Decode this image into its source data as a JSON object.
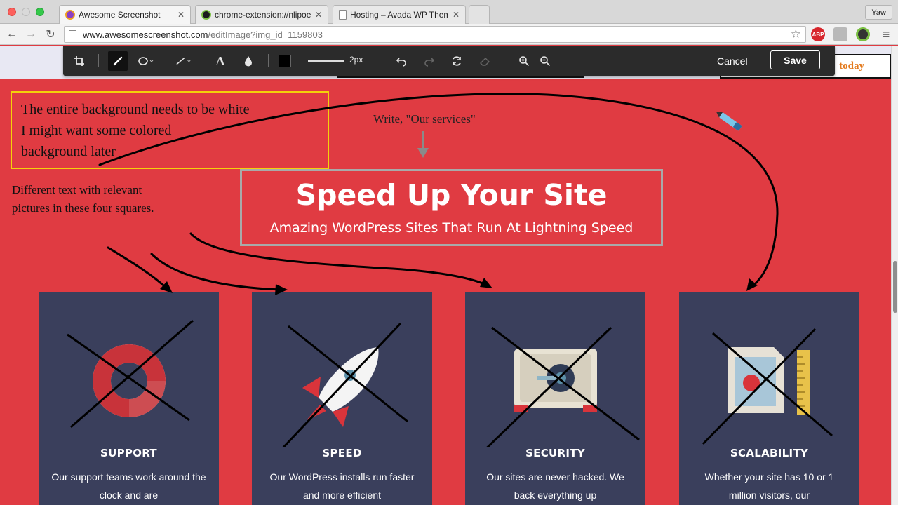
{
  "browser": {
    "profile_label": "Yaw",
    "tabs": [
      {
        "label": "Awesome Screenshot",
        "close": "✕",
        "icon_color": "#8a3fc4"
      },
      {
        "label": "chrome-extension://nlipoe",
        "close": "✕",
        "icon_color": "#1c1c1c"
      },
      {
        "label": "Hosting – Avada WP Theme",
        "close": "✕",
        "icon_color": "#ffffff"
      }
    ],
    "url_host": "www.awesomescreenshot.com",
    "url_path": "/editImage?img_id=1159803",
    "extensions": [
      {
        "name": "adblock-plus-icon",
        "label": "ABP",
        "color": "#d7262c"
      },
      {
        "name": "document-extension-icon",
        "label": "",
        "color": "#b9b9b9"
      },
      {
        "name": "screenshot-extension-icon",
        "label": "",
        "color": "#333333"
      }
    ]
  },
  "editor": {
    "line_width_label": "2px",
    "cancel_label": "Cancel",
    "save_label": "Save",
    "active_color": "#000000"
  },
  "site": {
    "header_cta": "today",
    "hero_title": "Speed Up Your Site",
    "hero_subtitle": "Amazing WordPress Sites That Run At Lightning Speed",
    "cards": [
      {
        "title": "SUPPORT",
        "desc": "Our support teams work around the clock and are"
      },
      {
        "title": "SPEED",
        "desc": "Our WordPress installs run faster and more efficient"
      },
      {
        "title": "SECURITY",
        "desc": "Our sites are never hacked. We back everything up"
      },
      {
        "title": "SCALABILITY",
        "desc": "Whether your site has 10 or 1 million visitors, our"
      }
    ],
    "accent_red": "#e03b42",
    "card_color": "#3a3f5c"
  },
  "annotations": {
    "note_box_lines": [
      "The entire background needs to be white",
      "I might want some colored",
      "background later"
    ],
    "note_squares_lines": [
      "Different text with relevant",
      "pictures in these four squares."
    ],
    "note_services": "Write, \"Our services\""
  }
}
